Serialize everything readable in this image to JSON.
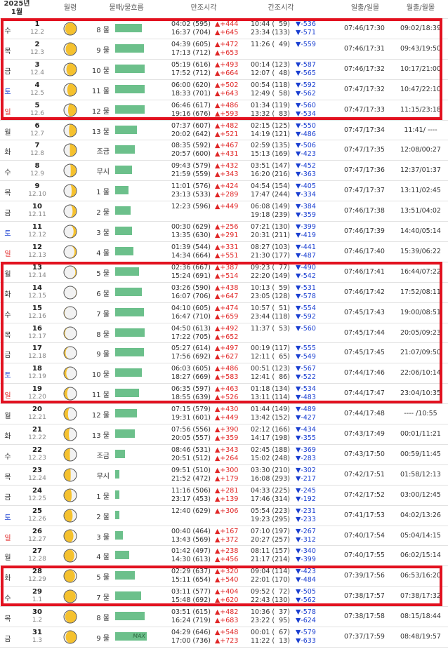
{
  "header": {
    "year": "2025년",
    "month": "1월",
    "moon_label": "월령",
    "tide_label": "물때/물흐름",
    "high_label": "만조시각",
    "low_label": "간조시각",
    "sun_label": "일출/일몰",
    "moonrise_label": "월출/월몰"
  },
  "colors": {
    "bar": "#6cc08b",
    "up": "#e02525",
    "down": "#1a3fd1",
    "sat": "#1a3fd1",
    "sun": "#e02525",
    "highlight": "#e2111f"
  },
  "rows": [
    {
      "dow": "수",
      "day": "1",
      "lunar": "12.2",
      "tide": "8 물",
      "bar": 0.62,
      "h1": "04:02 (595)",
      "hd1": "▲+444",
      "h2": "16:37 (704)",
      "hd2": "▲+645",
      "l1": "10:44 (  59)",
      "ld1": "▼-536",
      "l2": "23:34 (133)",
      "ld2": "▼-571",
      "sun": "07:46/17:30",
      "moon": "09:02/18:39"
    },
    {
      "dow": "목",
      "day": "2",
      "lunar": "12.3",
      "tide": "9 물",
      "bar": 0.66,
      "h1": "04:39 (605)",
      "hd1": "▲+472",
      "h2": "17:13 (712)",
      "hd2": "▲+653",
      "l1": "11:26 (  49)",
      "ld1": "▼-559",
      "l2": "",
      "ld2": "",
      "sun": "07:46/17:31",
      "moon": "09:43/19:50"
    },
    {
      "dow": "금",
      "day": "3",
      "lunar": "12.4",
      "tide": "10 물",
      "bar": 0.68,
      "h1": "05:19 (616)",
      "hd1": "▲+493",
      "h2": "17:52 (712)",
      "hd2": "▲+664",
      "l1": "00:14 (123)",
      "ld1": "▼-587",
      "l2": "12:07 (  48)",
      "ld2": "▼-565",
      "sun": "07:46/17:32",
      "moon": "10:17/21:00"
    },
    {
      "dow": "토",
      "day": "4",
      "lunar": "12.5",
      "tide": "11 물",
      "bar": 0.68,
      "h1": "06:00 (620)",
      "hd1": "▲+502",
      "h2": "18:33 (701)",
      "hd2": "▲+643",
      "l1": "00:54 (118)",
      "ld1": "▼-592",
      "l2": "12:49 (  58)",
      "ld2": "▼-562",
      "sun": "07:47/17:32",
      "moon": "10:47/22:10"
    },
    {
      "dow": "일",
      "day": "5",
      "lunar": "12.6",
      "tide": "12 물",
      "bar": 0.68,
      "h1": "06:46 (617)",
      "hd1": "▲+486",
      "h2": "19:16 (676)",
      "hd2": "▲+593",
      "l1": "01:34 (119)",
      "ld1": "▼-560",
      "l2": "13:32 (  83)",
      "ld2": "▼-534",
      "sun": "07:47/17:33",
      "moon": "11:15/23:18"
    },
    {
      "dow": "월",
      "day": "6",
      "lunar": "12.7",
      "tide": "13 물",
      "bar": 0.5,
      "h1": "07:37 (607)",
      "hd1": "▲+482",
      "h2": "20:02 (642)",
      "hd2": "▲+521",
      "l1": "02:15 (125)",
      "ld1": "▼-550",
      "l2": "14:19 (121)",
      "ld2": "▼-486",
      "sun": "07:47/17:34",
      "moon": "11:41/ ----"
    },
    {
      "dow": "화",
      "day": "7",
      "lunar": "12.8",
      "tide": "조금",
      "bar": 0.45,
      "h1": "08:35 (592)",
      "hd1": "▲+467",
      "h2": "20:57 (600)",
      "hd2": "▲+431",
      "l1": "02:59 (135)",
      "ld1": "▼-506",
      "l2": "15:13 (169)",
      "ld2": "▼-423",
      "sun": "07:47/17:35",
      "moon": "12:08/00:27"
    },
    {
      "dow": "수",
      "day": "8",
      "lunar": "12.9",
      "tide": "무시",
      "bar": 0.38,
      "h1": "09:43 (579)",
      "hd1": "▲+432",
      "h2": "21:59 (559)",
      "hd2": "▲+343",
      "l1": "03:51 (147)",
      "ld1": "▼-452",
      "l2": "16:20 (216)",
      "ld2": "▼-363",
      "sun": "07:47/17:36",
      "moon": "12:37/01:37"
    },
    {
      "dow": "목",
      "day": "9",
      "lunar": "12.10",
      "tide": "1 물",
      "bar": 0.31,
      "h1": "11:01 (576)",
      "hd1": "▲+424",
      "h2": "23:13 (533)",
      "hd2": "▲+289",
      "l1": "04:54 (154)",
      "ld1": "▼-405",
      "l2": "17:47 (244)",
      "ld2": "▼-334",
      "sun": "07:47/17:37",
      "moon": "13:11/02:45"
    },
    {
      "dow": "금",
      "day": "10",
      "lunar": "12.11",
      "tide": "2 물",
      "bar": 0.36,
      "h1": "12:23 (596)",
      "hd1": "▲+449",
      "h2": "",
      "hd2": "",
      "l1": "06:08 (149)",
      "ld1": "▼-384",
      "l2": "19:18 (239)",
      "ld2": "▼-359",
      "sun": "07:46/17:38",
      "moon": "13:51/04:02"
    },
    {
      "dow": "토",
      "day": "11",
      "lunar": "12.12",
      "tide": "3 물",
      "bar": 0.38,
      "h1": "00:30 (629)",
      "hd1": "▲+256",
      "h2": "13:35 (630)",
      "hd2": "▲+291",
      "l1": "07:21 (130)",
      "ld1": "▼-399",
      "l2": "20:31 (211)",
      "ld2": "▼-419",
      "sun": "07:46/17:39",
      "moon": "14:40/05:14"
    },
    {
      "dow": "일",
      "day": "12",
      "lunar": "12.13",
      "tide": "4 물",
      "bar": 0.42,
      "h1": "01:39 (544)",
      "hd1": "▲+331",
      "h2": "14:34 (664)",
      "hd2": "▲+551",
      "l1": "08:27 (103)",
      "ld1": "▼-441",
      "l2": "21:30 (177)",
      "ld2": "▼-487",
      "sun": "07:46/17:40",
      "moon": "15:39/06:22"
    },
    {
      "dow": "월",
      "day": "13",
      "lunar": "12.14",
      "tide": "5 물",
      "bar": 0.55,
      "mx": true,
      "h1": "02:36 (667)",
      "hd1": "▲+387",
      "h2": "15:24 (691)",
      "hd2": "▲+514",
      "l1": "09:23 (  77)",
      "ld1": "▼-490",
      "l2": "22:20 (149)",
      "ld2": "▼-542",
      "sun": "07:46/17:41",
      "moon": "16:44/07:22"
    },
    {
      "dow": "화",
      "day": "14",
      "lunar": "12.15",
      "tide": "6 물",
      "bar": 0.62,
      "h1": "03:26 (590)",
      "hd1": "▲+438",
      "h2": "16:07 (706)",
      "hd2": "▲+647",
      "l1": "10:13 (  59)",
      "ld1": "▼-531",
      "l2": "23:05 (128)",
      "ld2": "▼-578",
      "sun": "07:46/17:42",
      "moon": "17:52/08:11"
    },
    {
      "dow": "수",
      "day": "15",
      "lunar": "12.16",
      "tide": "7 물",
      "bar": 0.66,
      "h1": "04:10 (605)",
      "hd1": "▲+474",
      "h2": "16:47 (710)",
      "hd2": "▲+659",
      "l1": "10:57 (  51)",
      "ld1": "▼-554",
      "l2": "23:44 (118)",
      "ld2": "▼-592",
      "sun": "07:45/17:43",
      "moon": "19:00/08:51"
    },
    {
      "dow": "목",
      "day": "16",
      "lunar": "12.17",
      "tide": "8 물",
      "bar": 0.68,
      "h1": "04:50 (613)",
      "hd1": "▲+492",
      "h2": "17:22 (705)",
      "hd2": "▲+652",
      "l1": "11:37 (  53)",
      "ld1": "▼-560",
      "l2": "",
      "ld2": "",
      "sun": "07:45/17:44",
      "moon": "20:05/09:23"
    },
    {
      "dow": "금",
      "day": "17",
      "lunar": "12.18",
      "tide": "9 물",
      "bar": 0.66,
      "h1": "05:27 (614)",
      "hd1": "▲+497",
      "h2": "17:56 (692)",
      "hd2": "▲+627",
      "l1": "00:19 (117)",
      "ld1": "▼-555",
      "l2": "12:11 (  65)",
      "ld2": "▼-549",
      "sun": "07:45/17:45",
      "moon": "21:07/09:50"
    },
    {
      "dow": "토",
      "day": "18",
      "lunar": "12.19",
      "tide": "10 물",
      "bar": 0.62,
      "h1": "06:03 (605)",
      "hd1": "▲+486",
      "h2": "18:27 (669)",
      "hd2": "▲+583",
      "l1": "00:51 (123)",
      "ld1": "▼-567",
      "l2": "12:41 (  86)",
      "ld2": "▼-522",
      "sun": "07:44/17:46",
      "moon": "22:06/10:14"
    },
    {
      "dow": "일",
      "day": "19",
      "lunar": "12.20",
      "tide": "11 물",
      "bar": 0.55,
      "h1": "06:35 (597)",
      "hd1": "▲+463",
      "h2": "18:55 (639)",
      "hd2": "▲+526",
      "l1": "01:18 (134)",
      "ld1": "▼-534",
      "l2": "13:11 (114)",
      "ld2": "▼-483",
      "sun": "07:44/17:47",
      "moon": "23:04/10:35"
    },
    {
      "dow": "월",
      "day": "20",
      "lunar": "12.21",
      "tide": "12 물",
      "bar": 0.5,
      "h1": "07:15 (579)",
      "hd1": "▲+430",
      "h2": "19:31 (601)",
      "hd2": "▲+449",
      "l1": "01:44 (149)",
      "ld1": "▼-489",
      "l2": "13:42 (152)",
      "ld2": "▼-427",
      "sun": "07:44/17:48",
      "moon": "---- /10:55"
    },
    {
      "dow": "화",
      "day": "21",
      "lunar": "12.22",
      "tide": "13 물",
      "bar": 0.45,
      "h1": "07:56 (556)",
      "hd1": "▲+390",
      "h2": "20:05 (557)",
      "hd2": "▲+359",
      "l1": "02:12 (166)",
      "ld1": "▼-434",
      "l2": "14:17 (198)",
      "ld2": "▼-355",
      "sun": "07:43/17:49",
      "moon": "00:01/11:21"
    },
    {
      "dow": "수",
      "day": "22",
      "lunar": "12.23",
      "tide": "조금",
      "bar": 0.22,
      "h1": "08:46 (531)",
      "hd1": "▲+343",
      "h2": "20:51 (512)",
      "hd2": "▲+264",
      "l1": "02:45 (188)",
      "ld1": "▼-369",
      "l2": "15:02 (248)",
      "ld2": "▼-283",
      "sun": "07:43/17:50",
      "moon": "00:59/11:45"
    },
    {
      "dow": "목",
      "day": "23",
      "lunar": "12.24",
      "tide": "무시",
      "bar": 0.1,
      "h1": "09:51 (510)",
      "hd1": "▲+300",
      "h2": "21:52 (472)",
      "hd2": "▲+179",
      "l1": "03:30 (210)",
      "ld1": "▼-302",
      "l2": "16:08 (293)",
      "ld2": "▼-217",
      "sun": "07:42/17:51",
      "moon": "01:58/12:13"
    },
    {
      "dow": "금",
      "day": "24",
      "lunar": "12.25",
      "tide": "1 물",
      "bar": 0.1,
      "h1": "11:16 (506)",
      "hd1": "▲+281",
      "h2": "23:17 (453)",
      "hd2": "▲+139",
      "l1": "04:33 (225)",
      "ld1": "▼-245",
      "l2": "17:46 (314)",
      "ld2": "▼-192",
      "sun": "07:42/17:52",
      "moon": "03:00/12:45"
    },
    {
      "dow": "토",
      "day": "25",
      "lunar": "12.26",
      "tide": "2 물",
      "bar": 0.1,
      "h1": "12:40 (629)",
      "hd1": "▲+306",
      "h2": "",
      "hd2": "",
      "l1": "05:54 (223)",
      "ld1": "▼-231",
      "l2": "19:23 (295)",
      "ld2": "▼-233",
      "sun": "07:41/17:53",
      "moon": "04:02/13:26"
    },
    {
      "dow": "일",
      "day": "26",
      "lunar": "12.27",
      "tide": "3 물",
      "bar": 0.17,
      "h1": "00:40 (464)",
      "hd1": "▲+167",
      "h2": "13:43 (569)",
      "hd2": "▲+372",
      "l1": "07:10 (197)",
      "ld1": "▼-267",
      "l2": "20:27 (257)",
      "ld2": "▼-312",
      "sun": "07:40/17:54",
      "moon": "05:04/14:15"
    },
    {
      "dow": "월",
      "day": "27",
      "lunar": "12.28",
      "tide": "4 물",
      "bar": 0.32,
      "h1": "01:42 (497)",
      "hd1": "▲+238",
      "h2": "14:30 (613)",
      "hd2": "▲+456",
      "l1": "08:11 (157)",
      "ld1": "▼-340",
      "l2": "21:17 (214)",
      "ld2": "▼-399",
      "sun": "07:40/17:55",
      "moon": "06:02/15:14"
    },
    {
      "dow": "화",
      "day": "28",
      "lunar": "12.29",
      "tide": "5 물",
      "bar": 0.45,
      "h1": "02:29 (637)",
      "hd1": "▲+320",
      "h2": "15:11 (654)",
      "hd2": "▲+540",
      "l1": "09:04 (114)",
      "ld1": "▼-423",
      "l2": "22:01 (170)",
      "ld2": "▼-484",
      "sun": "07:39/17:56",
      "moon": "06:53/16:20"
    },
    {
      "dow": "수",
      "day": "29",
      "lunar": "1.1",
      "tide": "7 물",
      "bar": 0.6,
      "h1": "03:11 (577)",
      "hd1": "▲+404",
      "h2": "15:48 (692)",
      "hd2": "▲+620",
      "l1": "09:52 (  72)",
      "ld1": "▼-505",
      "l2": "22:43 (130)",
      "ld2": "▼-562",
      "sun": "07:38/17:57",
      "moon": "07:38/17:32"
    },
    {
      "dow": "목",
      "day": "30",
      "lunar": "1.2",
      "tide": "8 물",
      "bar": 0.68,
      "h1": "03:51 (615)",
      "hd1": "▲+482",
      "h2": "16:24 (719)",
      "hd2": "▲+683",
      "l1": "10:36 (  37)",
      "ld1": "▼-578",
      "l2": "23:22 (  95)",
      "ld2": "▼-624",
      "sun": "07:38/17:58",
      "moon": "08:15/18:44"
    },
    {
      "dow": "금",
      "day": "31",
      "lunar": "1.3",
      "tide": "9 물",
      "bar": 0.72,
      "mx": true,
      "mxlabel": "MAX",
      "h1": "04:29 (646)",
      "hd1": "▲+548",
      "h2": "17:00 (736)",
      "hd2": "▲+723",
      "l1": "00:01 (  67)",
      "ld1": "▼-579",
      "l2": "11:22 (  13)",
      "ld2": "▼-633",
      "sun": "07:37/17:59",
      "moon": "08:48/19:57"
    }
  ],
  "moon_phase": [
    0.08,
    0.12,
    0.18,
    0.25,
    0.32,
    0.4,
    0.47,
    0.54,
    0.62,
    0.7,
    0.78,
    0.86,
    0.93,
    0.99,
    0.98,
    0.94,
    0.89,
    0.83,
    0.76,
    0.69,
    0.61,
    0.53,
    0.46,
    0.38,
    0.3,
    0.23,
    0.16,
    0.1,
    0.04,
    0.07,
    0.12
  ],
  "highlights": [
    [
      0,
      4
    ],
    [
      12,
      18
    ],
    [
      27,
      28
    ]
  ]
}
